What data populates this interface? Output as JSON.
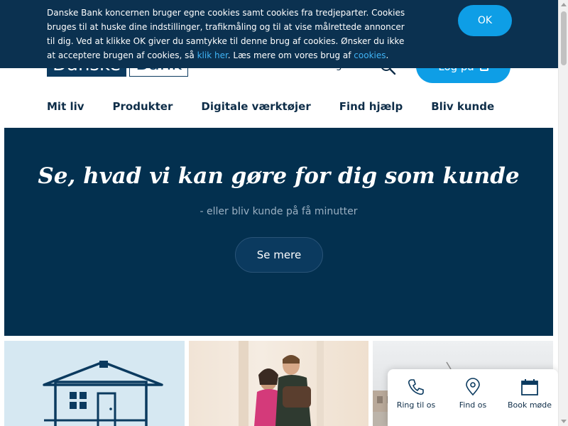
{
  "header": {
    "logo_left": "Danske",
    "logo_right": "Bank",
    "language_link": "English",
    "login_label": "Log på",
    "login_icon": "lock-icon",
    "search_icon": "search-icon"
  },
  "nav": {
    "items": [
      {
        "label": "Mit liv"
      },
      {
        "label": "Produkter"
      },
      {
        "label": "Digitale værktøjer"
      },
      {
        "label": "Find hjælp"
      },
      {
        "label": "Bliv kunde"
      }
    ]
  },
  "cookie_banner": {
    "text_1": "Danske Bank koncernen bruger egne cookies samt cookies fra tredjeparter. Cookies bruges til at huske dine indstillinger, trafikmåling og til at vise målrettede annoncer til dig. Ved at klikke OK giver du samtykke til denne brug af cookies. Ønsker du ikke at acceptere brugen af cookies, så ",
    "link_1": "klik her",
    "text_2": ". Læs mere om vores brug af ",
    "link_2": "cookies",
    "text_3": ".",
    "ok_label": "OK"
  },
  "hero": {
    "title": "Se, hvad vi kan gøre for dig som kunde",
    "subtitle": "- eller bliv kunde på få minutter",
    "button_label": "Se mere"
  },
  "contact": {
    "items": [
      {
        "label": "Ring til os",
        "icon": "phone-icon"
      },
      {
        "label": "Find os",
        "icon": "location-pin-icon"
      },
      {
        "label": "Book møde",
        "icon": "calendar-icon"
      }
    ]
  },
  "colors": {
    "brand_dark": "#03304f",
    "accent_blue": "#0e9ee6",
    "banner_bg": "#0b3150",
    "link_blue": "#3fb3f5"
  }
}
